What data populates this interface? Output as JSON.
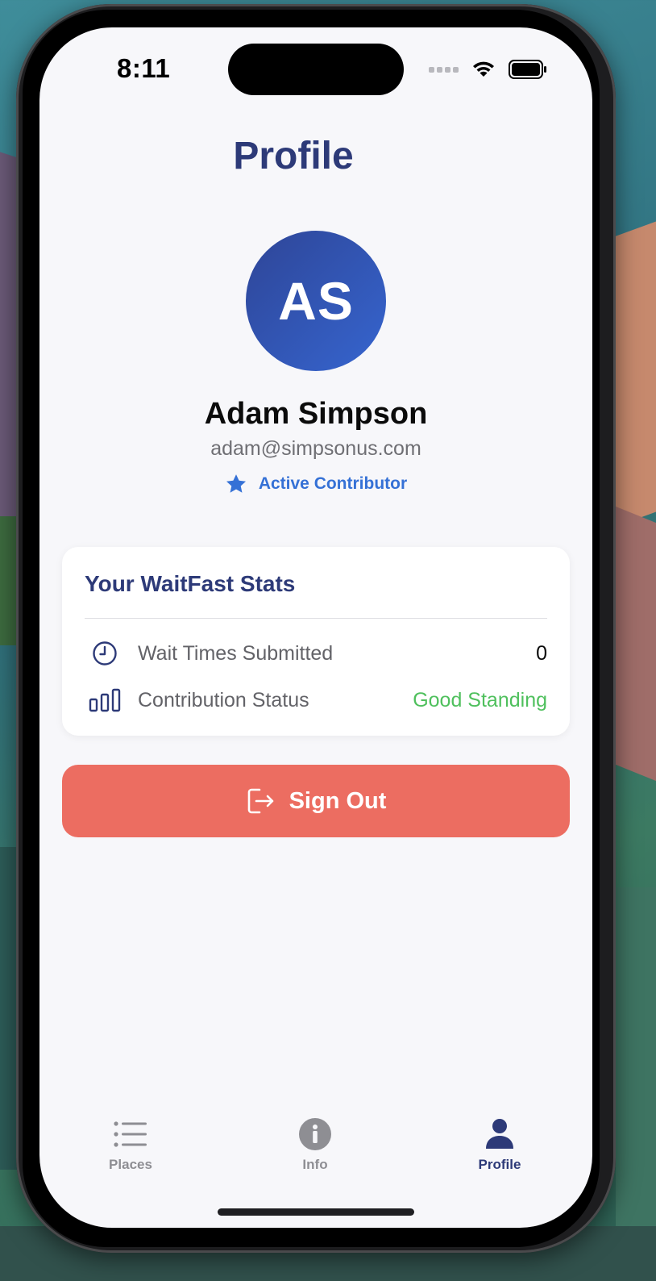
{
  "status_bar": {
    "time": "8:11"
  },
  "header": {
    "title": "Profile"
  },
  "profile": {
    "initials": "AS",
    "name": "Adam Simpson",
    "email": "adam@simpsonus.com",
    "badge_label": "Active Contributor",
    "badge_icon": "star-icon"
  },
  "stats": {
    "title": "Your WaitFast Stats",
    "rows": [
      {
        "icon": "clock-icon",
        "label": "Wait Times Submitted",
        "value": "0"
      },
      {
        "icon": "bar-chart-icon",
        "label": "Contribution Status",
        "value": "Good Standing",
        "value_color": "#4fc05d"
      }
    ]
  },
  "actions": {
    "sign_out_label": "Sign Out",
    "sign_out_color": "#ec6d61"
  },
  "tab_bar": {
    "items": [
      {
        "label": "Places",
        "icon": "list-icon",
        "active": false
      },
      {
        "label": "Info",
        "icon": "info-icon",
        "active": false
      },
      {
        "label": "Profile",
        "icon": "person-icon",
        "active": true
      }
    ]
  },
  "colors": {
    "primary": "#2d3a78",
    "accent": "#3571d6",
    "danger": "#ec6d61",
    "success": "#4fc05d"
  }
}
